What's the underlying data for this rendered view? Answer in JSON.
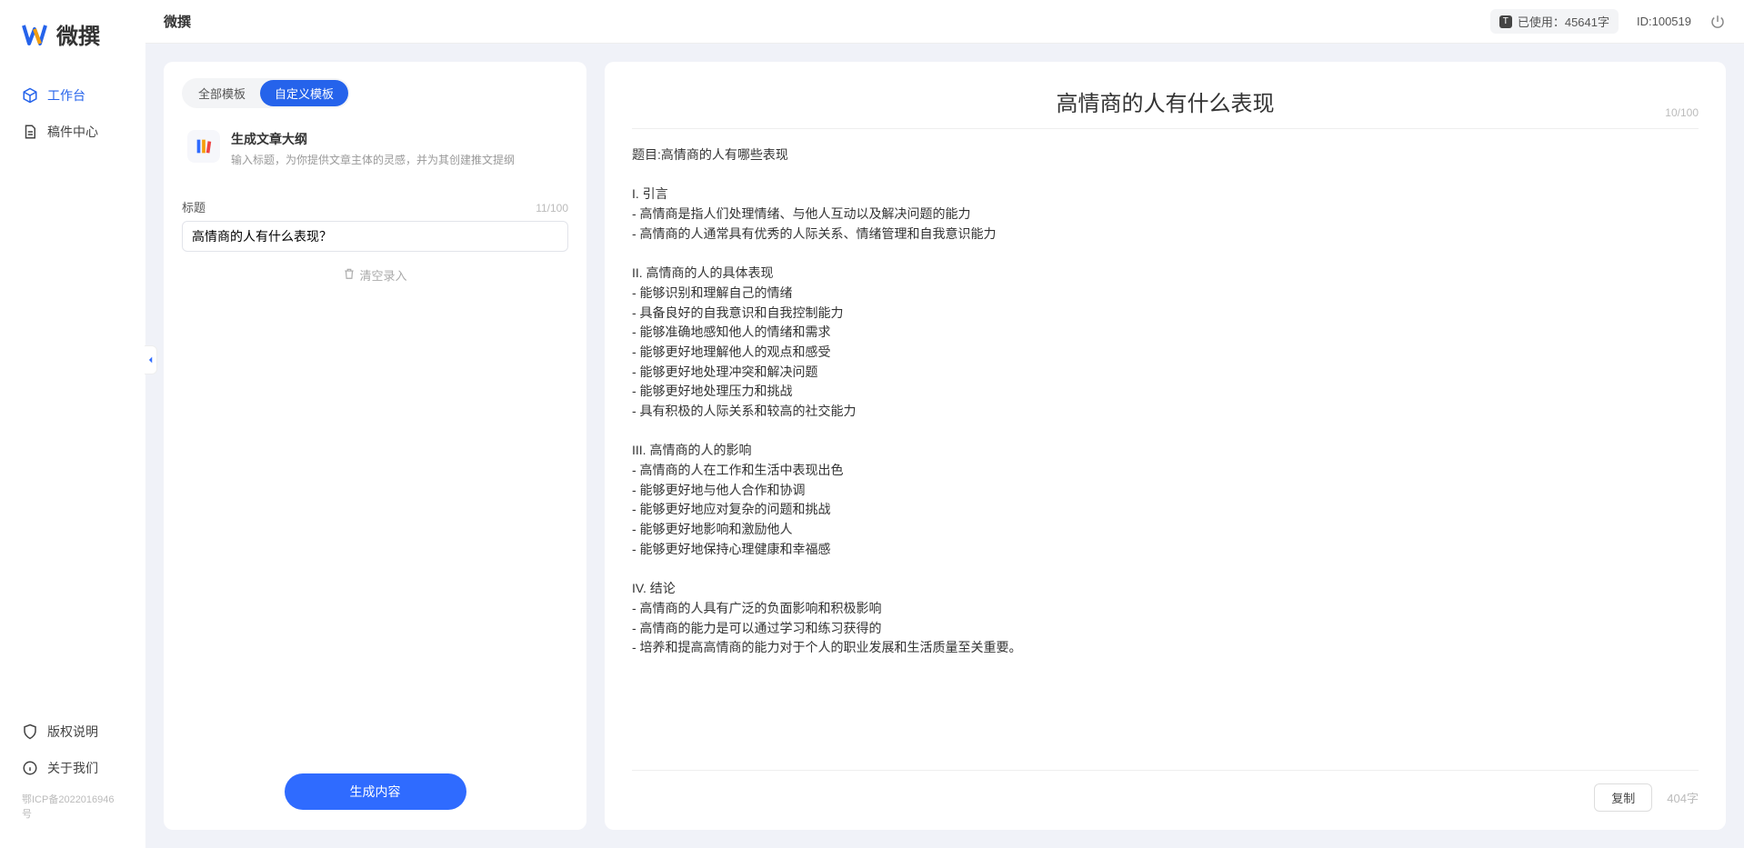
{
  "brand": "微撰",
  "sidebar": {
    "items": [
      {
        "label": "工作台"
      },
      {
        "label": "稿件中心"
      }
    ],
    "footer": [
      {
        "label": "版权说明"
      },
      {
        "label": "关于我们"
      }
    ],
    "icp": "鄂ICP备2022016946号"
  },
  "header": {
    "title": "微撰",
    "usage": "已使用：45641字",
    "user_id": "ID:100519"
  },
  "left": {
    "tabs": [
      {
        "label": "全部模板"
      },
      {
        "label": "自定义模板"
      }
    ],
    "template": {
      "title": "生成文章大纲",
      "desc": "输入标题，为你提供文章主体的灵感，并为其创建推文提纲"
    },
    "field_label": "标题",
    "char_count": "11/100",
    "title_value": "高情商的人有什么表现？",
    "clear_label": "清空录入",
    "generate_label": "生成内容"
  },
  "right": {
    "doc_title": "高情商的人有什么表现",
    "title_count": "10/100",
    "copy_label": "复制",
    "word_total": "404字",
    "body": "题目:高情商的人有哪些表现\n\nI. 引言\n- 高情商是指人们处理情绪、与他人互动以及解决问题的能力\n- 高情商的人通常具有优秀的人际关系、情绪管理和自我意识能力\n\nII. 高情商的人的具体表现\n- 能够识别和理解自己的情绪\n- 具备良好的自我意识和自我控制能力\n- 能够准确地感知他人的情绪和需求\n- 能够更好地理解他人的观点和感受\n- 能够更好地处理冲突和解决问题\n- 能够更好地处理压力和挑战\n- 具有积极的人际关系和较高的社交能力\n\nIII. 高情商的人的影响\n- 高情商的人在工作和生活中表现出色\n- 能够更好地与他人合作和协调\n- 能够更好地应对复杂的问题和挑战\n- 能够更好地影响和激励他人\n- 能够更好地保持心理健康和幸福感\n\nIV. 结论\n- 高情商的人具有广泛的负面影响和积极影响\n- 高情商的能力是可以通过学习和练习获得的\n- 培养和提高高情商的能力对于个人的职业发展和生活质量至关重要。"
  }
}
